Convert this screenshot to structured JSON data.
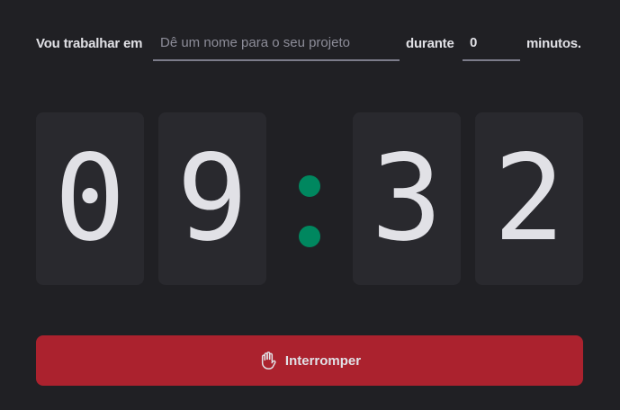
{
  "form": {
    "task_label": "Vou trabalhar em",
    "task_placeholder": "Dê um nome para o seu projeto",
    "task_value": "",
    "duration_label": "durante",
    "minutes_value": "0",
    "minutes_suffix": "minutos."
  },
  "countdown": {
    "minutes_tens": "0",
    "minutes_ones": "9",
    "separator": ":",
    "seconds_tens": "3",
    "seconds_ones": "2"
  },
  "stop_button": {
    "label": "Interromper",
    "icon": "hand-palm-icon"
  },
  "colors": {
    "background": "#202024",
    "digit_card": "#29292e",
    "separator": "#00875f",
    "stop_button": "#ab222e",
    "text": "#e1e1e6",
    "placeholder": "#8d8d99"
  }
}
